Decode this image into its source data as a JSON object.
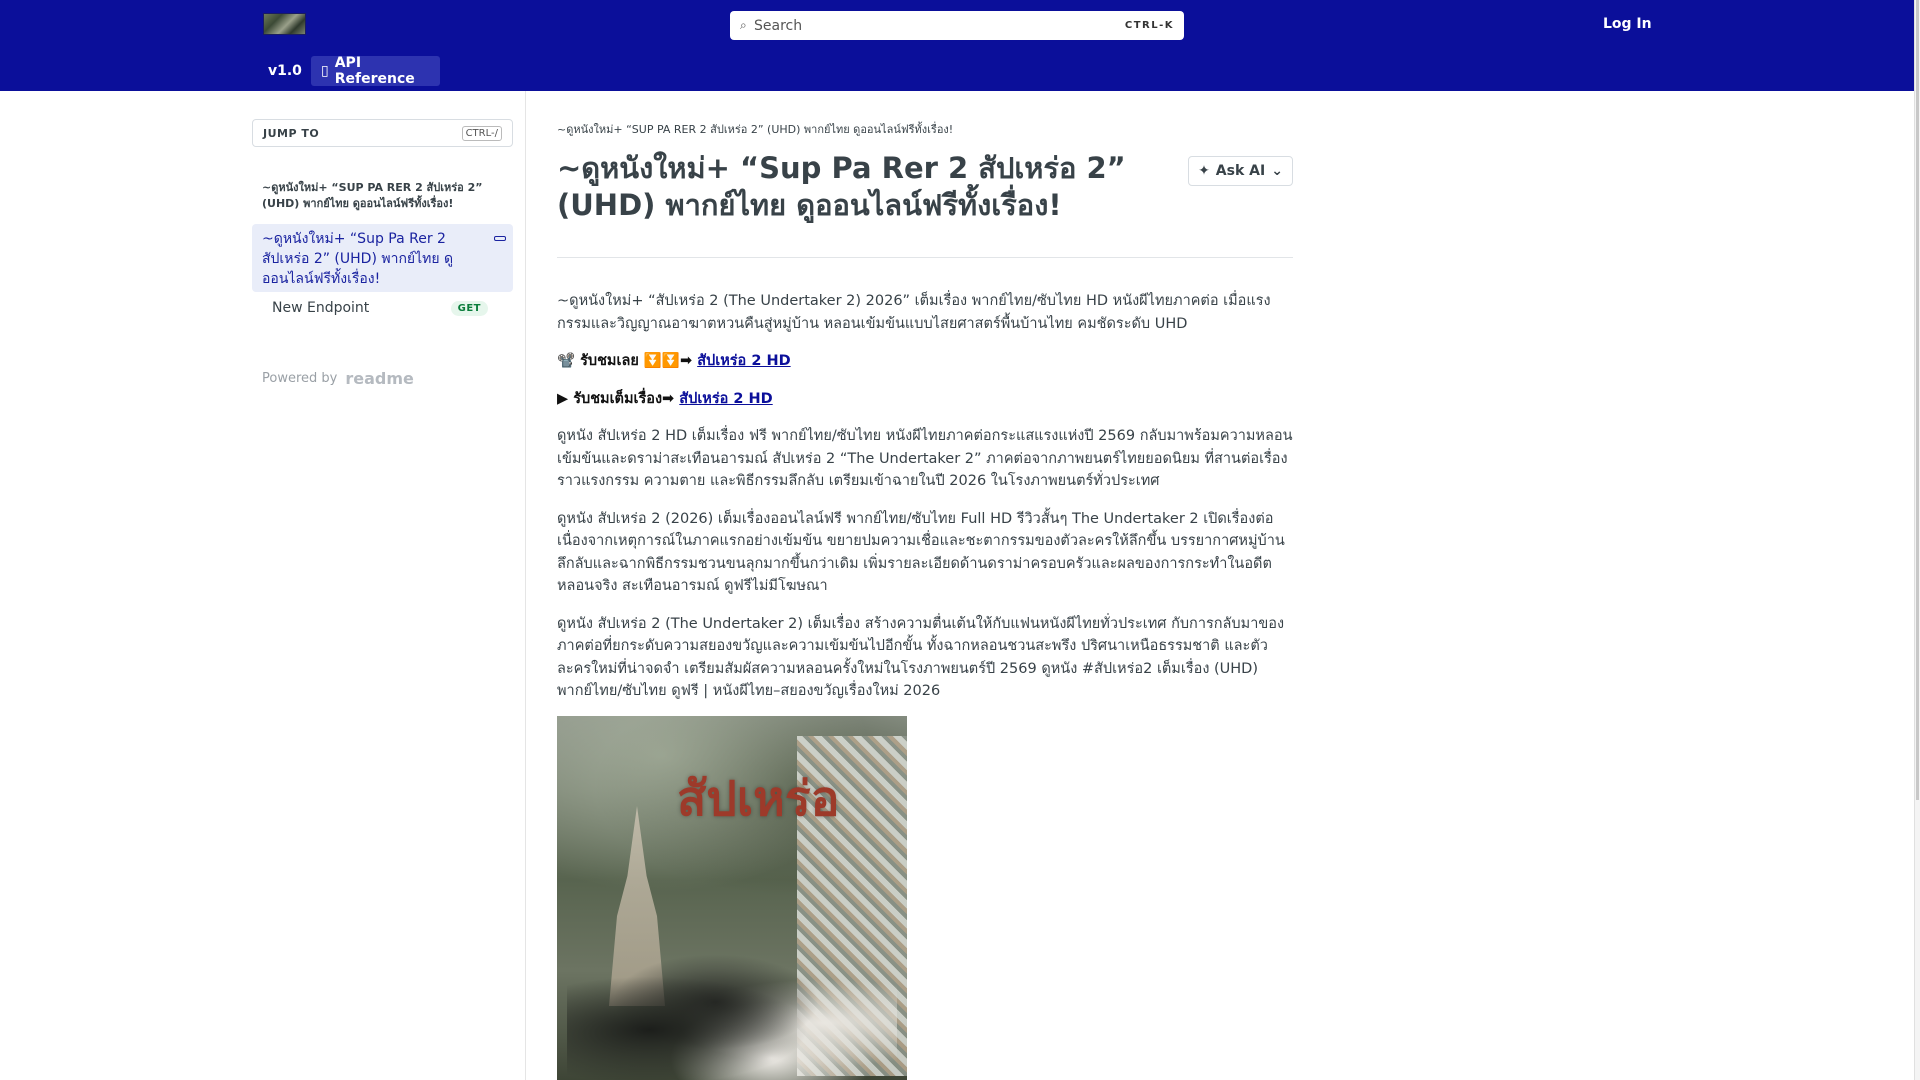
{
  "header": {
    "search_placeholder": "Search",
    "search_shortcut": "CTRL-K",
    "login_label": "Log In",
    "version_label": "v1.0",
    "api_tab_label": "API Reference"
  },
  "sidebar": {
    "jump_label": "JUMP TO",
    "jump_shortcut": "CTRL-/",
    "section_heading": "~ดูหนังใหม่+ “SUP PA RER 2 สัปเหร่อ 2” (UHD) พากย์ไทย ดูออนไลน์ฟรีทั้งเรื่อง!",
    "active_item": "~ดูหนังใหม่+ “Sup Pa Rer 2 สัปเหร่อ 2” (UHD) พากย์ไทย ดูออนไลน์ฟรีทั้งเรื่อง!",
    "endpoint_name": "New Endpoint",
    "endpoint_verb": "GET",
    "powered_by": "Powered by",
    "powered_brand": "readme"
  },
  "main": {
    "breadcrumb": "~ดูหนังใหม่+ “SUP PA RER 2 สัปเหร่อ 2” (UHD) พากย์ไทย ดูออนไลน์ฟรีทั้งเรื่อง!",
    "title": "~ดูหนังใหม่+ “Sup Pa Rer 2 สัปเหร่อ 2” (UHD) พากย์ไทย ดูออนไลน์ฟรีทั้งเรื่อง!",
    "ask_ai_label": "Ask AI",
    "intro": "~ดูหนังใหม่+ “สัปเหร่อ 2 (The Undertaker 2) 2026” เต็มเรื่อง พากย์ไทย/ซับไทย HD หนังผีไทยภาคต่อ เมื่อแรงกรรมและวิญญาณอาฆาตหวนคืนสู่หมู่บ้าน หลอนเข้มข้นแบบไสยศาสตร์พื้นบ้านไทย คมชัดระดับ UHD",
    "watch_prefix_1": "📽️ รับชมเลย ⏬⏬➡",
    "watch_link_1": "สัปเหร่อ 2 HD",
    "watch_prefix_2": "▶ รับชมเต็มเรื่อง➡",
    "watch_link_2": "สัปเหร่อ 2 HD",
    "para1": "ดูหนัง สัปเหร่อ 2 HD เต็มเรื่อง ฟรี พากย์ไทย/ซับไทย หนังผีไทยภาคต่อกระแสแรงแห่งปี 2569 กลับมาพร้อมความหลอนเข้มข้นและดราม่าสะเทือนอารมณ์ สัปเหร่อ 2 “The Undertaker 2” ภาคต่อจากภาพยนตร์ไทยยอดนิยม ที่สานต่อเรื่องราวแรงกรรม ความตาย และพิธีกรรมลึกลับ เตรียมเข้าฉายในปี 2026 ในโรงภาพยนตร์ทั่วประเทศ",
    "para2": "ดูหนัง สัปเหร่อ 2 (2026) เต็มเรื่องออนไลน์ฟรี พากย์ไทย/ซับไทย Full HD รีวิวสั้นๆ The Undertaker 2 เปิดเรื่องต่อเนื่องจากเหตุการณ์ในภาคแรกอย่างเข้มข้น ขยายปมความเชื่อและชะตากรรมของตัวละครให้ลึกขึ้น บรรยากาศหมู่บ้านลึกลับและฉากพิธีกรรมชวนขนลุกมากขึ้นกว่าเดิม เพิ่มรายละเอียดด้านดราม่าครอบครัวและผลของการกระทำในอดีต หลอนจริง สะเทือนอารมณ์ ดูฟรีไม่มีโฆษณา",
    "para3": "ดูหนัง สัปเหร่อ 2 (The Undertaker 2) เต็มเรื่อง สร้างความตื่นเต้นให้กับแฟนหนังผีไทยทั่วประเทศ กับการกลับมาของภาคต่อที่ยกระดับความสยองขวัญและความเข้มข้นไปอีกขั้น ทั้งฉากหลอนชวนสะพรึง ปริศนาเหนือธรรมชาติ และตัวละครใหม่ที่น่าจดจำ เตรียมสัมผัสความหลอนครั้งใหม่ในโรงภาพยนตร์ปี 2569 ดูหนัง #สัปเหร่อ2 เต็มเรื่อง (UHD) พากย์ไทย/ซับไทย ดูฟรี | หนังผีไทย–สยองขวัญเรื่องใหม่ 2026"
  },
  "poster": {
    "title_text": "สัปเหร่อ"
  },
  "colors": {
    "header_bg": "#0b0f9a",
    "link": "#0b0f9a",
    "active_bg": "#e9edf9"
  }
}
